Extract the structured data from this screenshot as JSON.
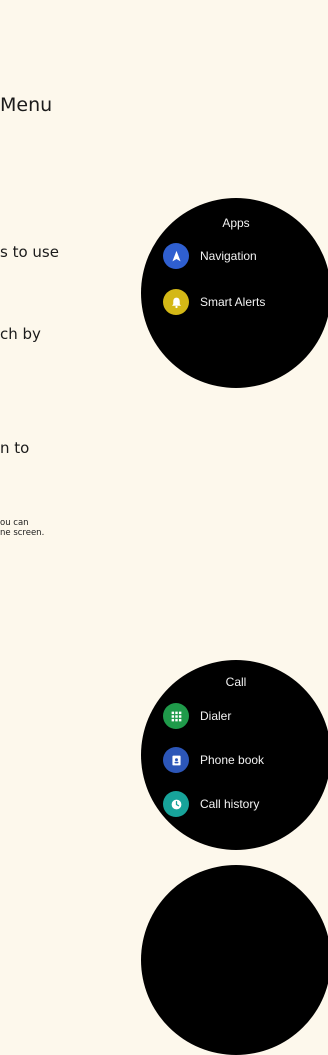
{
  "heading": "Menu",
  "body_lines": [
    "s to use",
    "ch by",
    "n to"
  ],
  "footnote_lines": [
    "ou can",
    "ne screen."
  ],
  "watch_apps": {
    "title": "Apps",
    "items": [
      {
        "label": "Navigation",
        "icon": "navigation-icon",
        "color": "#2f5fd0"
      },
      {
        "label": "Smart Alerts",
        "icon": "bell-icon",
        "color": "#d4b816"
      }
    ]
  },
  "watch_call": {
    "title": "Call",
    "items": [
      {
        "label": "Dialer",
        "icon": "dialpad-icon",
        "color": "#1f9a4a"
      },
      {
        "label": "Phone book",
        "icon": "contacts-icon",
        "color": "#2c56b8"
      },
      {
        "label": "Call history",
        "icon": "clock-icon",
        "color": "#17a39a"
      }
    ]
  }
}
